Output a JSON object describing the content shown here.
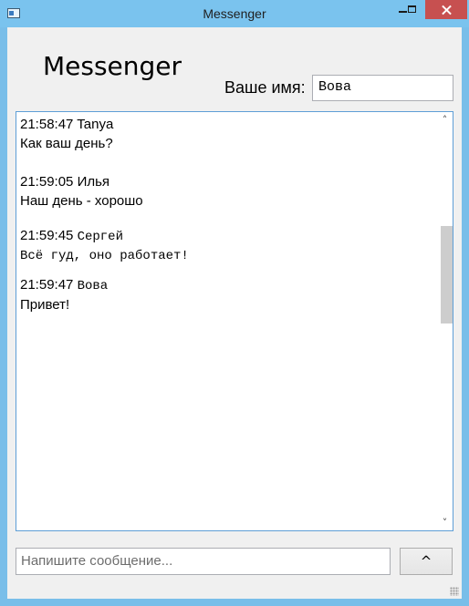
{
  "window": {
    "title": "Messenger"
  },
  "header": {
    "app_title": "Messenger",
    "name_label": "Ваше имя:",
    "name_value": "Вова"
  },
  "chat": {
    "messages": [
      {
        "time": "21:58:47",
        "author": "Tanya",
        "text": "Как ваш день?"
      },
      {
        "time": "21:59:05",
        "author": "Илья",
        "text": "Наш день - хорошо"
      },
      {
        "time": "21:59:45",
        "author": "Сергей",
        "text": "Всё гуд, оно работает!"
      },
      {
        "time": "21:59:47",
        "author": "Вова",
        "text": "Привет!"
      }
    ],
    "scroll_up_glyph": "˄",
    "scroll_down_glyph": "˅"
  },
  "composer": {
    "placeholder": "Напишите сообщение...",
    "send_label": "^"
  },
  "icons": {
    "app": "window-app-icon",
    "minimize": "minimize-icon",
    "maximize": "maximize-icon",
    "close": "close-icon",
    "resize": "resize-grip-icon"
  }
}
